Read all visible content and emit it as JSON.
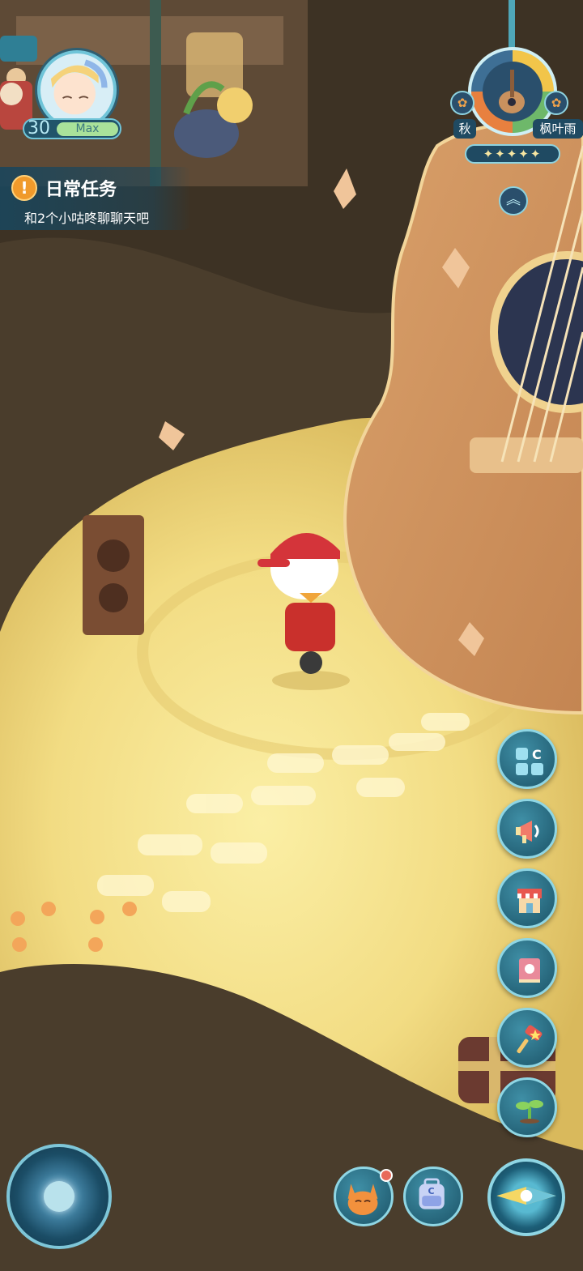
{
  "player": {
    "level": "30",
    "level_tag": "Max"
  },
  "quest": {
    "title": "日常任务",
    "description": "和2个小咕咚聊聊天吧",
    "icon": "!"
  },
  "season": {
    "season_label": "秋",
    "weather_label": "枫叶雨",
    "stars": "✦✦✦✦✦"
  },
  "side_buttons": [
    {
      "name": "collection-button",
      "icon": "grid-c-icon"
    },
    {
      "name": "announcement-button",
      "icon": "megaphone-icon"
    },
    {
      "name": "shop-button",
      "icon": "shop-icon"
    },
    {
      "name": "handbook-button",
      "icon": "book-icon"
    },
    {
      "name": "auction-button",
      "icon": "hammer-icon"
    },
    {
      "name": "planting-button",
      "icon": "sprout-icon"
    }
  ],
  "bottom_buttons": [
    {
      "name": "pet-button",
      "icon": "fox-pet-icon",
      "notification": true
    },
    {
      "name": "backpack-button",
      "icon": "backpack-icon"
    }
  ],
  "colors": {
    "hud_teal": "#1c5468",
    "hud_border": "#8fd6e4",
    "quest_orange": "#f09a2b"
  }
}
